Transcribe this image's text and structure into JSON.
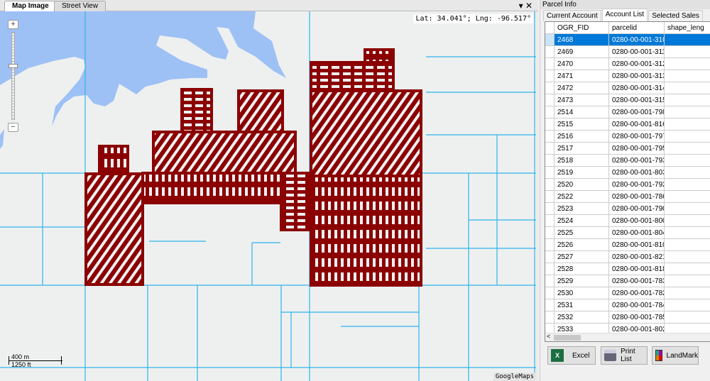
{
  "map_panel": {
    "tabs": [
      {
        "label": "Map Image",
        "active": true
      },
      {
        "label": "Street View",
        "active": false
      }
    ],
    "window_controls": {
      "dropdown": "▾",
      "close": "✕"
    },
    "coordinates": "Lat: 34.041°; Lng: -96.517°",
    "zoom": {
      "in": "+",
      "out": "−"
    },
    "scale": {
      "metric": "400 m",
      "imperial": "1250 ft"
    },
    "attribution": "GoogleMaps",
    "colors": {
      "water": "#9dc1f5",
      "land": "#eef0f0",
      "parcel_lines": "#2fb4ea",
      "selected_parcels": "#8b0000"
    }
  },
  "parcel_panel": {
    "title": "Parcel Info",
    "tabs": [
      {
        "label": "Current Account",
        "active": false
      },
      {
        "label": "Account List",
        "active": true
      },
      {
        "label": "Selected Sales",
        "active": false
      }
    ],
    "columns": [
      "OGR_FID",
      "parcelid",
      "shape_leng"
    ],
    "rows": [
      [
        "2468",
        "0280-00-001-310..."
      ],
      [
        "2469",
        "0280-00-001-311..."
      ],
      [
        "2470",
        "0280-00-001-312..."
      ],
      [
        "2471",
        "0280-00-001-313..."
      ],
      [
        "2472",
        "0280-00-001-314..."
      ],
      [
        "2473",
        "0280-00-001-315..."
      ],
      [
        "2514",
        "0280-00-001-798..."
      ],
      [
        "2515",
        "0280-00-001-816..."
      ],
      [
        "2516",
        "0280-00-001-797..."
      ],
      [
        "2517",
        "0280-00-001-795..."
      ],
      [
        "2518",
        "0280-00-001-793..."
      ],
      [
        "2519",
        "0280-00-001-803..."
      ],
      [
        "2520",
        "0280-00-001-792..."
      ],
      [
        "2522",
        "0280-00-001-786..."
      ],
      [
        "2523",
        "0280-00-001-790..."
      ],
      [
        "2524",
        "0280-00-001-800..."
      ],
      [
        "2525",
        "0280-00-001-804..."
      ],
      [
        "2526",
        "0280-00-001-810..."
      ],
      [
        "2527",
        "0280-00-001-821..."
      ],
      [
        "2528",
        "0280-00-001-818..."
      ],
      [
        "2529",
        "0280-00-001-783..."
      ],
      [
        "2530",
        "0280-00-001-782..."
      ],
      [
        "2531",
        "0280-00-001-784..."
      ],
      [
        "2532",
        "0280-00-001-785..."
      ],
      [
        "2533",
        "0280-00-001-802..."
      ]
    ],
    "selected_row": 0,
    "buttons": {
      "excel": "Excel",
      "print": "Print List",
      "landmark": "LandMark"
    },
    "accent": "#0078d7"
  }
}
